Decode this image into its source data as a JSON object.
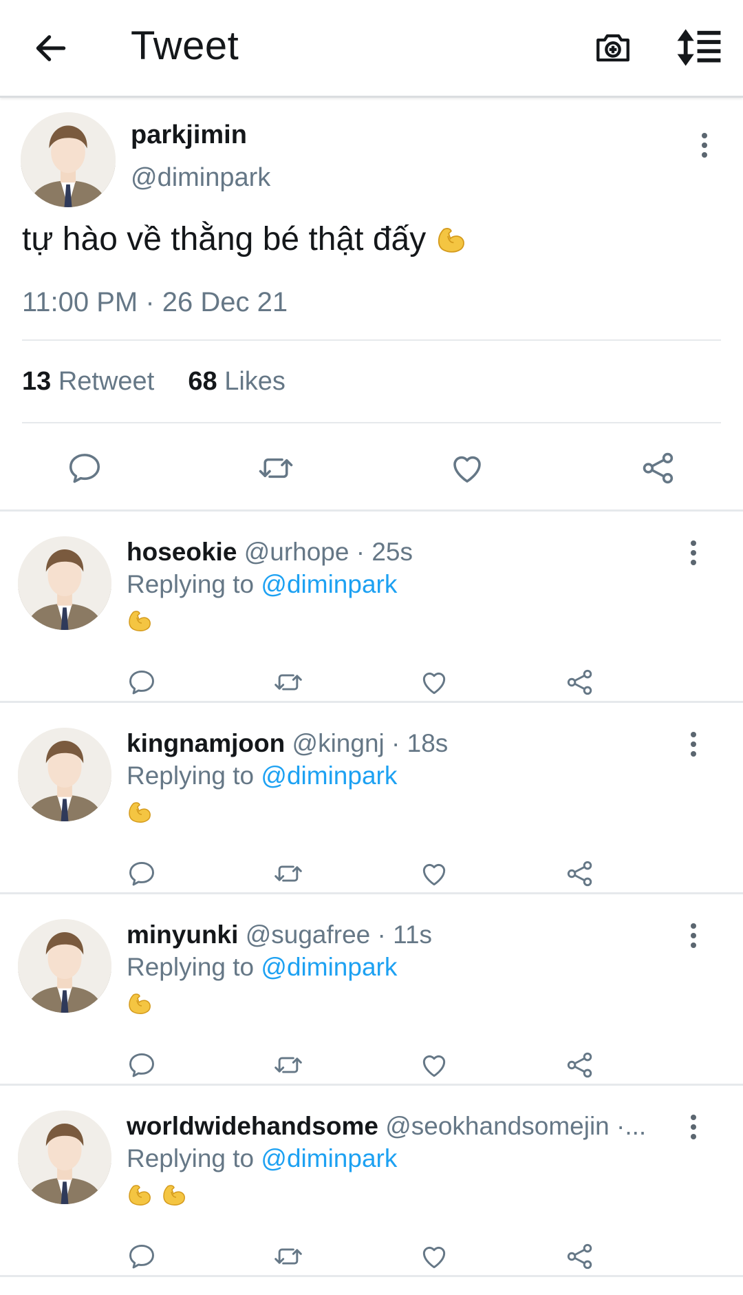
{
  "header": {
    "title": "Tweet",
    "back_icon": "arrow-left-icon",
    "camera_icon": "camera-plus-icon",
    "sort_icon": "sort-list-icon"
  },
  "tweet": {
    "display_name": "parkjimin",
    "handle": "@diminpark",
    "text": "tự hào về thằng bé thật đấy",
    "emoji": "flexed-biceps",
    "timestamp": "11:00 PM · 26 Dec 21",
    "retweets_count": "13",
    "retweets_label": "Retweet",
    "likes_count": "68",
    "likes_label": "Likes"
  },
  "replies": [
    {
      "name": "hoseokie",
      "meta": "@urhope · 25s",
      "replying_prefix": "Replying to",
      "replying_to": "@diminpark",
      "emoji_count": 1
    },
    {
      "name": "kingnamjoon",
      "meta": "@kingnj · 18s",
      "replying_prefix": "Replying to",
      "replying_to": "@diminpark",
      "emoji_count": 1
    },
    {
      "name": "minyunki",
      "meta": "@sugafree · 11s",
      "replying_prefix": "Replying to",
      "replying_to": "@diminpark",
      "emoji_count": 1
    },
    {
      "name": "worldwidehandsome",
      "meta": "@seokhandsomejin ·...",
      "replying_prefix": "Replying to",
      "replying_to": "@diminpark",
      "emoji_count": 2
    }
  ],
  "colors": {
    "text": "#14171a",
    "secondary": "#657786",
    "link": "#1da1f2",
    "divider": "#e6e9ec",
    "icon": "#657786"
  }
}
